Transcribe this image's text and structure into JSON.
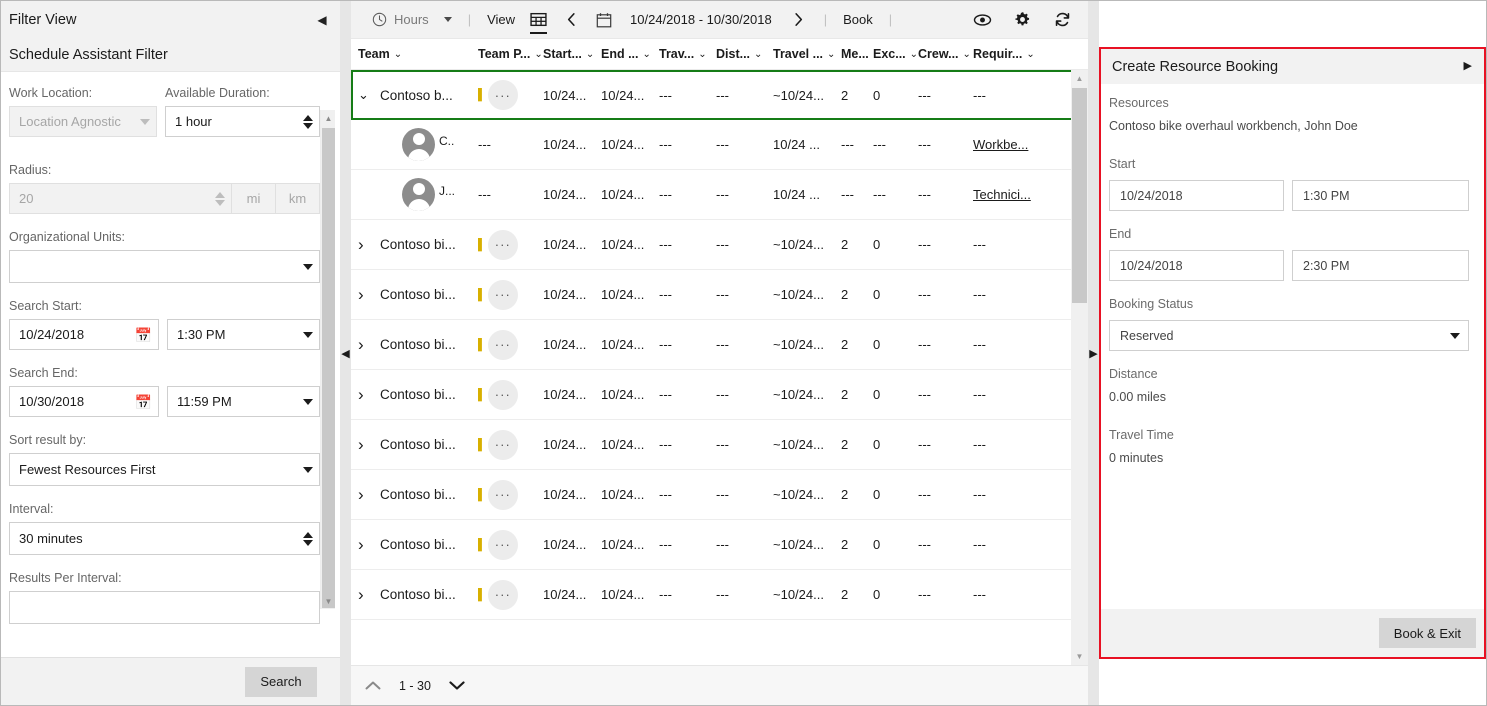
{
  "filter_panel": {
    "title": "Filter View",
    "collapse_icon": "chevron-left-icon",
    "subtitle": "Schedule Assistant Filter",
    "fields": {
      "work_location_label": "Work Location:",
      "work_location_value": "Location Agnostic",
      "available_duration_label": "Available Duration:",
      "available_duration_value": "1 hour",
      "radius_label": "Radius:",
      "radius_value": "20",
      "unit_mi": "mi",
      "unit_km": "km",
      "org_units_label": "Organizational Units:",
      "org_units_value": "",
      "search_start_label": "Search Start:",
      "search_start_date": "10/24/2018",
      "search_start_time": "1:30 PM",
      "search_end_label": "Search End:",
      "search_end_date": "10/30/2018",
      "search_end_time": "11:59 PM",
      "sort_label": "Sort result by:",
      "sort_value": "Fewest Resources First",
      "interval_label": "Interval:",
      "interval_value": "30 minutes",
      "results_per_interval_label": "Results Per Interval:"
    },
    "search_button": "Search"
  },
  "toolbar": {
    "clock_icon": "clock-icon",
    "hours_label": "Hours",
    "view_label": "View",
    "grid_icon": "grid-view-icon",
    "prev_icon": "chevron-left-icon",
    "calendar_icon": "calendar-icon",
    "date_range": "10/24/2018 - 10/30/2018",
    "next_icon": "chevron-right-icon",
    "book_label": "Book",
    "separator": "|",
    "eye_icon": "eye-icon",
    "gear_icon": "gear-icon",
    "refresh_icon": "refresh-icon"
  },
  "table": {
    "columns": [
      {
        "label": "Team",
        "width": 120
      },
      {
        "label": "Team P...",
        "width": 65
      },
      {
        "label": "Start...",
        "width": 58
      },
      {
        "label": "End ...",
        "width": 58
      },
      {
        "label": "Trav...",
        "width": 57
      },
      {
        "label": "Dist...",
        "width": 57
      },
      {
        "label": "Travel ...",
        "width": 68
      },
      {
        "label": "Me...",
        "width": 32
      },
      {
        "label": "Exc...",
        "width": 45
      },
      {
        "label": "Crew...",
        "width": 55
      },
      {
        "label": "Requir...",
        "width": 60
      }
    ],
    "selected_row": {
      "expand_icon": "chevron-down-icon",
      "team": "Contoso b...",
      "menu_icon": "ellipsis-icon",
      "start": "10/24...",
      "end": "10/24...",
      "travel": "---",
      "distance": "---",
      "travel_time": "~10/24...",
      "members": "2",
      "exceptions": "0",
      "crew": "---",
      "requirements": "---"
    },
    "child_rows": [
      {
        "avatar": "person-avatar",
        "name": "C..",
        "team_pref": "---",
        "start": "10/24...",
        "end": "10/24...",
        "travel": "---",
        "distance": "---",
        "travel_time": "10/24 ...",
        "members": "---",
        "exceptions": "---",
        "crew": "---",
        "requirements": "Workbe..."
      },
      {
        "avatar": "person-avatar",
        "name": "J...",
        "team_pref": "---",
        "start": "10/24...",
        "end": "10/24...",
        "travel": "---",
        "distance": "---",
        "travel_time": "10/24 ...",
        "members": "---",
        "exceptions": "---",
        "crew": "---",
        "requirements": "Technici..."
      }
    ],
    "rows": [
      {
        "expand_icon": "chevron-right-icon",
        "team": "Contoso bi...",
        "menu_icon": "ellipsis-icon",
        "start": "10/24...",
        "end": "10/24...",
        "travel": "---",
        "distance": "---",
        "travel_time": "~10/24...",
        "members": "2",
        "exceptions": "0",
        "crew": "---",
        "requirements": "---"
      },
      {
        "expand_icon": "chevron-right-icon",
        "team": "Contoso bi...",
        "menu_icon": "ellipsis-icon",
        "start": "10/24...",
        "end": "10/24...",
        "travel": "---",
        "distance": "---",
        "travel_time": "~10/24...",
        "members": "2",
        "exceptions": "0",
        "crew": "---",
        "requirements": "---"
      },
      {
        "expand_icon": "chevron-right-icon",
        "team": "Contoso bi...",
        "menu_icon": "ellipsis-icon",
        "start": "10/24...",
        "end": "10/24...",
        "travel": "---",
        "distance": "---",
        "travel_time": "~10/24...",
        "members": "2",
        "exceptions": "0",
        "crew": "---",
        "requirements": "---"
      },
      {
        "expand_icon": "chevron-right-icon",
        "team": "Contoso bi...",
        "menu_icon": "ellipsis-icon",
        "start": "10/24...",
        "end": "10/24...",
        "travel": "---",
        "distance": "---",
        "travel_time": "~10/24...",
        "members": "2",
        "exceptions": "0",
        "crew": "---",
        "requirements": "---"
      },
      {
        "expand_icon": "chevron-right-icon",
        "team": "Contoso bi...",
        "menu_icon": "ellipsis-icon",
        "start": "10/24...",
        "end": "10/24...",
        "travel": "---",
        "distance": "---",
        "travel_time": "~10/24...",
        "members": "2",
        "exceptions": "0",
        "crew": "---",
        "requirements": "---"
      },
      {
        "expand_icon": "chevron-right-icon",
        "team": "Contoso bi...",
        "menu_icon": "ellipsis-icon",
        "start": "10/24...",
        "end": "10/24...",
        "travel": "---",
        "distance": "---",
        "travel_time": "~10/24...",
        "members": "2",
        "exceptions": "0",
        "crew": "---",
        "requirements": "---"
      },
      {
        "expand_icon": "chevron-right-icon",
        "team": "Contoso bi...",
        "menu_icon": "ellipsis-icon",
        "start": "10/24...",
        "end": "10/24...",
        "travel": "---",
        "distance": "---",
        "travel_time": "~10/24...",
        "members": "2",
        "exceptions": "0",
        "crew": "---",
        "requirements": "---"
      },
      {
        "expand_icon": "chevron-right-icon",
        "team": "Contoso bi...",
        "menu_icon": "ellipsis-icon",
        "start": "10/24...",
        "end": "10/24...",
        "travel": "---",
        "distance": "---",
        "travel_time": "~10/24...",
        "members": "2",
        "exceptions": "0",
        "crew": "---",
        "requirements": "---"
      }
    ],
    "pager": {
      "up_icon": "chevron-up-icon",
      "range": "1 - 30",
      "down_icon": "chevron-down-icon"
    }
  },
  "booking_panel": {
    "title": "Create Resource Booking",
    "expand_icon": "chevron-right-icon",
    "resources_label": "Resources",
    "resources_value": "Contoso bike overhaul workbench, John Doe",
    "start_label": "Start",
    "start_date": "10/24/2018",
    "start_time": "1:30 PM",
    "end_label": "End",
    "end_date": "10/24/2018",
    "end_time": "2:30 PM",
    "booking_status_label": "Booking Status",
    "booking_status_value": "Reserved",
    "distance_label": "Distance",
    "distance_value": "0.00 miles",
    "travel_time_label": "Travel Time",
    "travel_time_value": "0 minutes",
    "book_exit_button": "Book & Exit"
  },
  "dividers": {
    "left_arrow": "chevron-left-icon",
    "right_arrow": "chevron-right-icon"
  },
  "colors": {
    "selection_green": "#157c16",
    "highlight_red": "#e81123",
    "toolbar_bg": "#f2f2f2"
  }
}
